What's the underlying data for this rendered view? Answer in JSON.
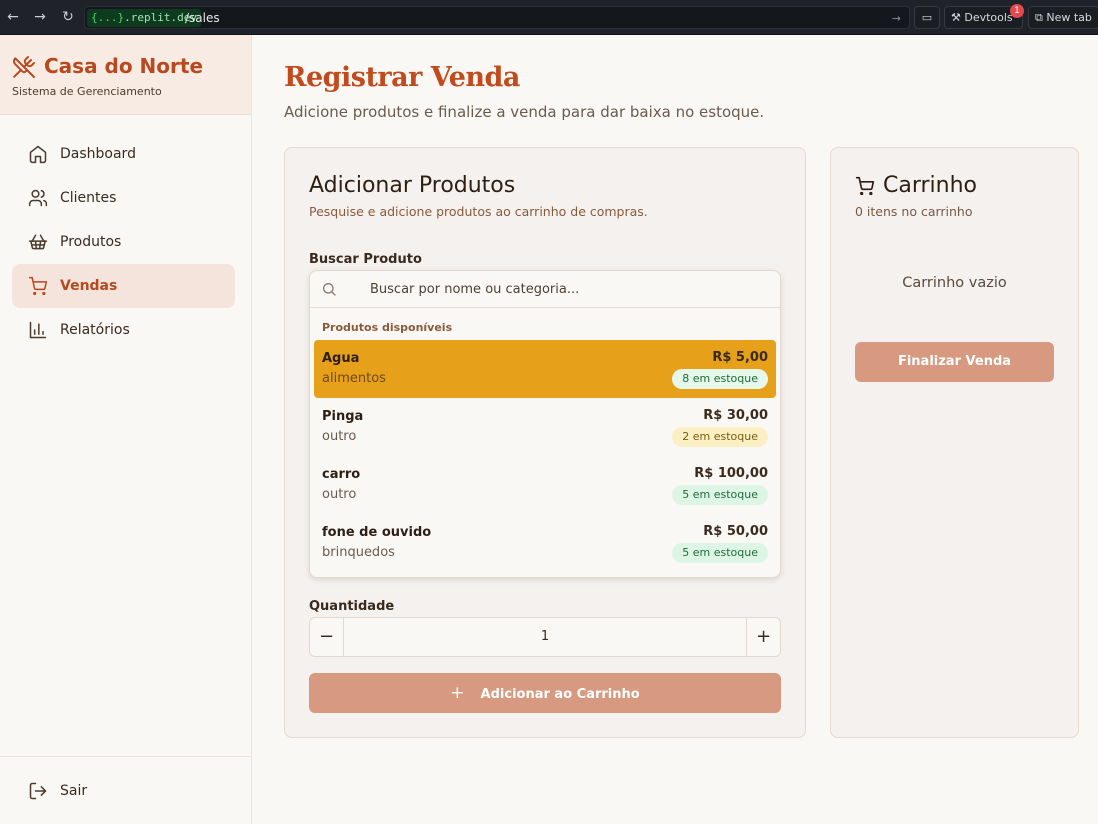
{
  "browser": {
    "url_host": "{...}",
    "url_host_suffix": ".replit.dev",
    "url_path": "/sales",
    "devtools_label": "Devtools",
    "devtools_badge": "1",
    "new_tab_label": "New tab"
  },
  "sidebar": {
    "brand_title": "Casa do Norte",
    "brand_subtitle": "Sistema de Gerenciamento",
    "items": [
      {
        "label": "Dashboard",
        "icon": "home-icon",
        "active": false
      },
      {
        "label": "Clientes",
        "icon": "users-icon",
        "active": false
      },
      {
        "label": "Produtos",
        "icon": "basket-icon",
        "active": false
      },
      {
        "label": "Vendas",
        "icon": "cart-icon",
        "active": true
      },
      {
        "label": "Relatórios",
        "icon": "bar-chart-icon",
        "active": false
      }
    ],
    "logout_label": "Sair"
  },
  "page": {
    "title": "Registrar Venda",
    "subtitle": "Adicione produtos e finalize a venda para dar baixa no estoque."
  },
  "add_products": {
    "title": "Adicionar Produtos",
    "description": "Pesquise e adicione produtos ao carrinho de compras.",
    "search_label": "Buscar Produto",
    "search_placeholder": "Buscar por nome ou categoria...",
    "group_heading": "Produtos disponíveis",
    "products": [
      {
        "name": "Agua",
        "category": "alimentos",
        "price": "R$ 5,00",
        "stock": "8 em estoque"
      },
      {
        "name": "Pinga",
        "category": "outro",
        "price": "R$ 30,00",
        "stock": "2 em estoque"
      },
      {
        "name": "carro",
        "category": "outro",
        "price": "R$ 100,00",
        "stock": "5 em estoque"
      },
      {
        "name": "fone de ouvido",
        "category": "brinquedos",
        "price": "R$ 50,00",
        "stock": "5 em estoque"
      }
    ],
    "quantity_label": "Quantidade",
    "quantity_value": "1",
    "minus_symbol": "−",
    "plus_symbol": "+",
    "add_button_label": "Adicionar ao Carrinho"
  },
  "cart": {
    "title": "Carrinho",
    "count_text": "0 itens no carrinho",
    "empty_text": "Carrinho vazio",
    "finalize_label": "Finalizar Venda"
  },
  "colors": {
    "accent": "#b8491f",
    "highlight": "#e6a01a",
    "button": "#d79a80"
  }
}
